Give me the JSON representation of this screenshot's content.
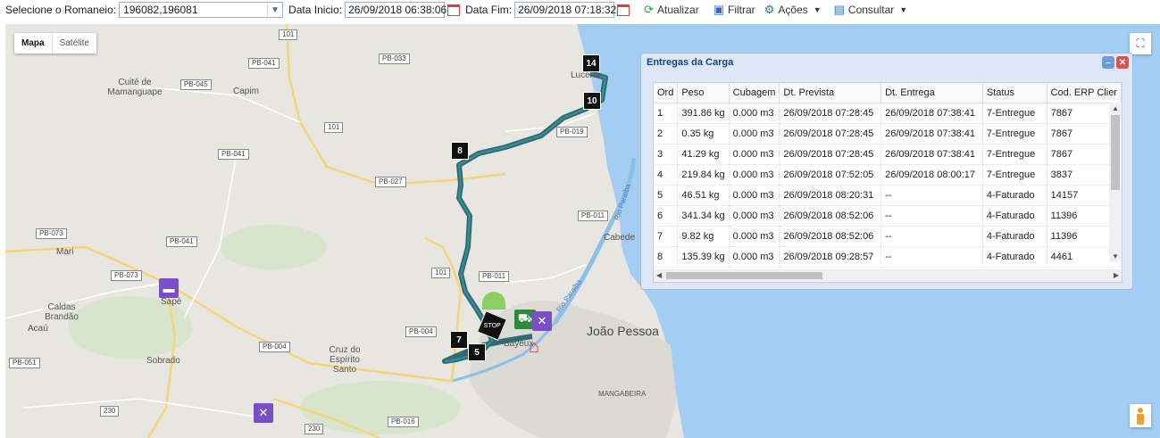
{
  "toolbar": {
    "romaneio_label": "Selecione o Romaneio:",
    "romaneio_value": "196082,196081",
    "inicio_label": "Data Inicio:",
    "inicio_value": "26/09/2018 06:38:06",
    "fim_label": "Data Fim:",
    "fim_value": "26/09/2018 07:18:32",
    "atualizar": "Atualizar",
    "filtrar": "Filtrar",
    "acoes": "Ações",
    "consultar": "Consultar"
  },
  "map": {
    "type_mapa": "Mapa",
    "type_satelite": "Satélite",
    "road_tags": [
      "101",
      "PB-033",
      "PB-045",
      "PB-041",
      "101",
      "PB-019",
      "PB-041",
      "PB-027",
      "PB-073",
      "PB-041",
      "PB-011",
      "PB-073",
      "101",
      "PB-011",
      "PB-004",
      "PB-004",
      "PB-051",
      "230",
      "PB-016",
      "230"
    ],
    "places": [
      "Cuité de Mamanguape",
      "Capim",
      "Lucena",
      "Mari",
      "Sapé",
      "Caldas Brandão",
      "Acaú",
      "Sobrado",
      "Cruz do Espírito Santo",
      "Cabede",
      "Bayeux",
      "MANGABEIRA"
    ],
    "city": "João Pessoa",
    "river1": "Rio Paraíba",
    "river2": "Rio Paraíba",
    "markers": [
      "14",
      "10",
      "8",
      "7",
      "5"
    ],
    "stop": "STOP"
  },
  "panel": {
    "title": "Entregas da Carga",
    "columns": [
      "Ord",
      "Peso",
      "Cubagem",
      "Dt. Prevista",
      "Dt. Entrega",
      "Status",
      "Cod. ERP Clier"
    ],
    "rows": [
      [
        "1",
        "391.86 kg",
        "0.000 m3",
        "26/09/2018 07:28:45",
        "26/09/2018 07:38:41",
        "7-Entregue",
        "7867"
      ],
      [
        "2",
        "0.35 kg",
        "0.000 m3",
        "26/09/2018 07:28:45",
        "26/09/2018 07:38:41",
        "7-Entregue",
        "7867"
      ],
      [
        "3",
        "41.29 kg",
        "0.000 m3",
        "26/09/2018 07:28:45",
        "26/09/2018 07:38:41",
        "7-Entregue",
        "7867"
      ],
      [
        "4",
        "219.84 kg",
        "0.000 m3",
        "26/09/2018 07:52:05",
        "26/09/2018 08:00:17",
        "7-Entregue",
        "3837"
      ],
      [
        "5",
        "46.51 kg",
        "0.000 m3",
        "26/09/2018 08:20:31",
        "--",
        "4-Faturado",
        "14157"
      ],
      [
        "6",
        "341.34 kg",
        "0.000 m3",
        "26/09/2018 08:52:06",
        "--",
        "4-Faturado",
        "11396"
      ],
      [
        "7",
        "9.82 kg",
        "0.000 m3",
        "26/09/2018 08:52:06",
        "--",
        "4-Faturado",
        "11396"
      ],
      [
        "8",
        "135.39 kg",
        "0.000 m3",
        "26/09/2018 09:28:57",
        "--",
        "4-Faturado",
        "4461"
      ]
    ]
  },
  "colors": {
    "route": "#2e6b72",
    "sea": "#a4cdf3",
    "water": "#8cc0e8",
    "poi": "#7b4fc4"
  }
}
